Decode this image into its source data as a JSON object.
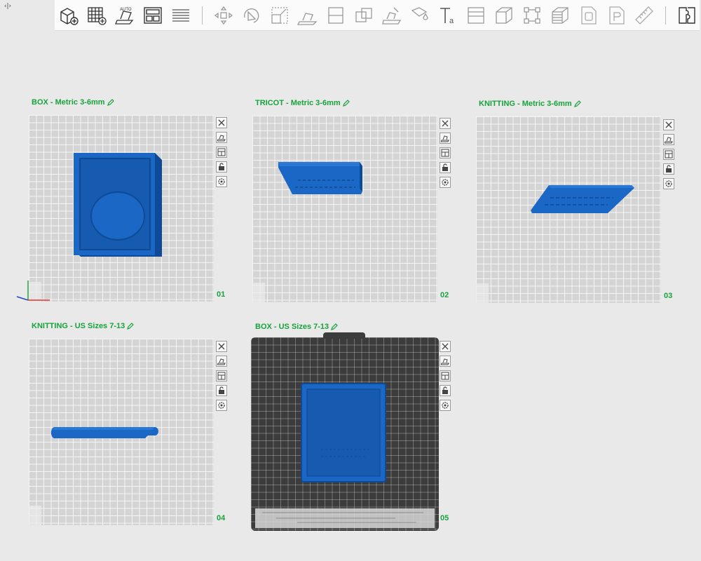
{
  "collapse_glyph": "‹|›",
  "toolbar": {
    "icons": [
      "add-cube-icon",
      "add-plate-icon",
      "auto-arrange-icon",
      "plate-layout-icon",
      "layers-list-icon",
      "move-icon",
      "rotate-icon",
      "scale-icon",
      "lay-on-face-icon",
      "cut-icon",
      "boolean-icon",
      "paint-icon",
      "support-paint-icon",
      "text-icon",
      "variable-height-icon",
      "cube-view-icon",
      "assembly-icon",
      "sla-stack-icon",
      "object-o-icon",
      "object-p-icon",
      "measure-icon",
      "split-parts-icon"
    ]
  },
  "plates": [
    {
      "title": "BOX - Metric 3-6mm",
      "number": "01"
    },
    {
      "title": "TRICOT - Metric 3-6mm",
      "number": "02"
    },
    {
      "title": "KNITTING - Metric 3-6mm",
      "number": "03"
    },
    {
      "title": "KNITTING - US Sizes 7-13",
      "number": "04"
    },
    {
      "title": "BOX - US Sizes 7-13",
      "number": "05"
    }
  ],
  "plate_tool_icons": [
    "close-icon",
    "arrange-icon",
    "layout-icon",
    "lock-icon",
    "settings-icon"
  ],
  "colors": {
    "accent": "#17a33b",
    "model": "#1b67c5",
    "model_dark": "#0f4a97",
    "plate": "#d4d4d4",
    "textured_plate": "#3c3c3c"
  }
}
